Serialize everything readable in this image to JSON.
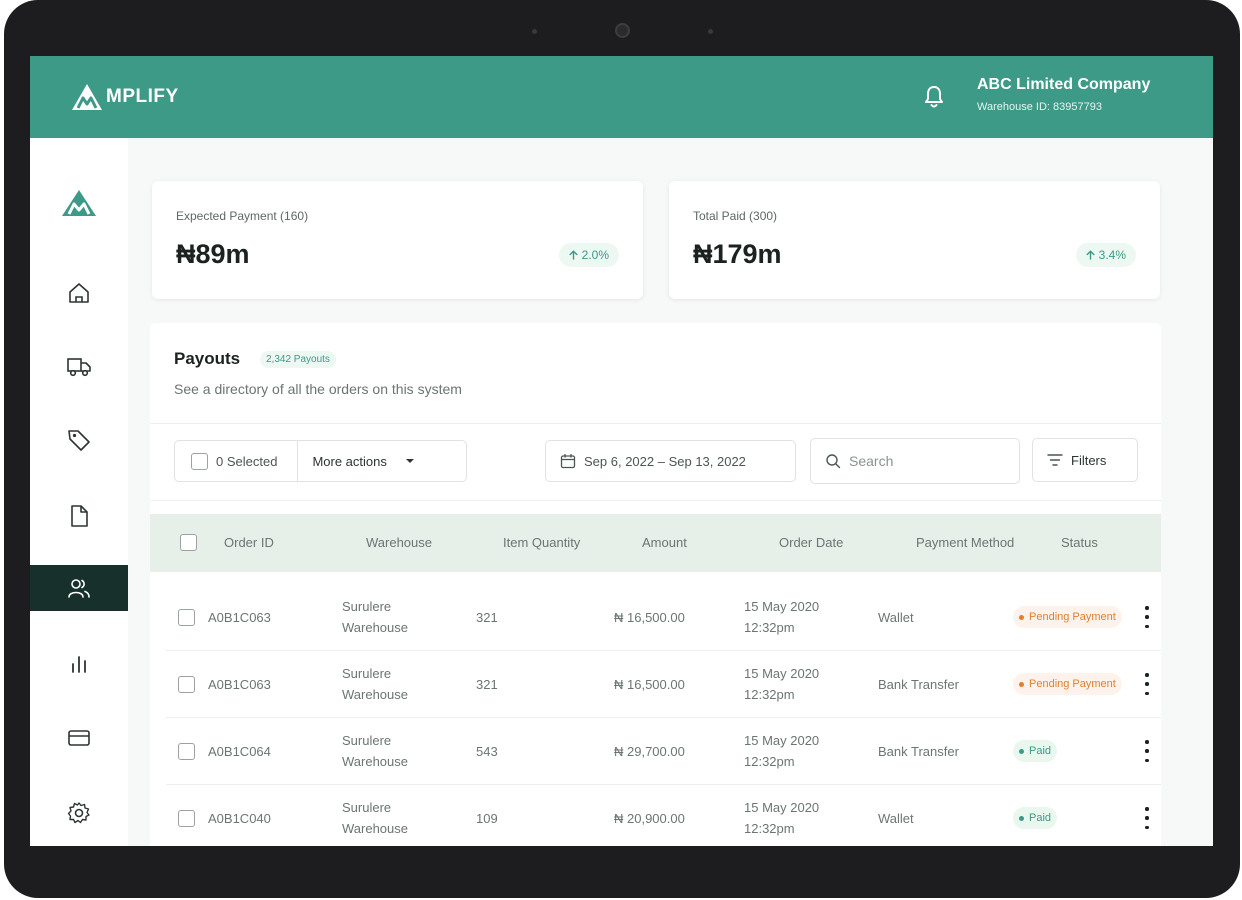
{
  "header": {
    "logo_text": "MPLIFY",
    "company_name": "ABC Limited Company",
    "warehouse_id": "Warehouse ID: 83957793"
  },
  "sidebar": {
    "items": [
      {
        "icon": "home-icon"
      },
      {
        "icon": "truck-icon"
      },
      {
        "icon": "tag-icon"
      },
      {
        "icon": "document-icon"
      },
      {
        "icon": "users-icon",
        "active": true
      },
      {
        "icon": "bar-chart-icon"
      },
      {
        "icon": "credit-card-icon"
      },
      {
        "icon": "settings-icon"
      }
    ]
  },
  "stats": [
    {
      "label": "Expected Payment (160)",
      "value": "₦89m",
      "change": "2.0%"
    },
    {
      "label": "Total Paid (300)",
      "value": "₦179m",
      "change": "3.4%"
    }
  ],
  "payouts": {
    "title": "Payouts",
    "count": "2,342 Payouts",
    "subtitle": "See a directory of all the orders on this system"
  },
  "toolbar": {
    "selected_label": "0 Selected",
    "more_actions_label": "More actions",
    "date_range": "Sep 6, 2022 – Sep 13, 2022",
    "search_placeholder": "Search",
    "filters_label": "Filters"
  },
  "table": {
    "columns": [
      "Order ID",
      "Warehouse",
      "Item Quantity",
      "Amount",
      "Order Date",
      "Payment Method",
      "Status"
    ],
    "rows": [
      {
        "order_id": "A0B1C063",
        "warehouse_1": "Surulere",
        "warehouse_2": "Warehouse",
        "quantity": "321",
        "amount": "₦ 16,500.00",
        "date_1": "15 May 2020",
        "date_2": "12:32pm",
        "method": "Wallet",
        "status": "Pending Payment",
        "status_type": "pending"
      },
      {
        "order_id": "A0B1C063",
        "warehouse_1": "Surulere",
        "warehouse_2": "Warehouse",
        "quantity": "321",
        "amount": "₦ 16,500.00",
        "date_1": "15 May 2020",
        "date_2": "12:32pm",
        "method": "Bank Transfer",
        "status": "Pending Payment",
        "status_type": "pending"
      },
      {
        "order_id": "A0B1C064",
        "warehouse_1": "Surulere",
        "warehouse_2": "Warehouse",
        "quantity": "543",
        "amount": "₦ 29,700.00",
        "date_1": "15 May 2020",
        "date_2": "12:32pm",
        "method": "Bank Transfer",
        "status": "Paid",
        "status_type": "paid"
      },
      {
        "order_id": "A0B1C040",
        "warehouse_1": "Surulere",
        "warehouse_2": "Warehouse",
        "quantity": "109",
        "amount": "₦ 20,900.00",
        "date_1": "15 May 2020",
        "date_2": "12:32pm",
        "method": "Wallet",
        "status": "Paid",
        "status_type": "paid"
      }
    ]
  },
  "colors": {
    "brand": "#3c9a86",
    "sidebar_active": "#18302b",
    "pending": "#e0802f",
    "paid": "#3c9a86"
  }
}
